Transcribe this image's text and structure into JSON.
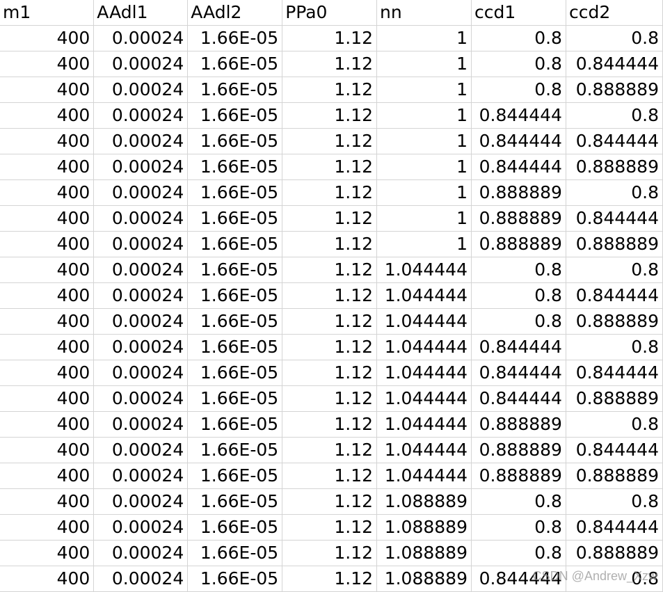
{
  "sheet": {
    "headers": [
      "m1",
      "AAdl1",
      "AAdl2",
      "PPa0",
      "nn",
      "ccd1",
      "ccd2"
    ],
    "rows": [
      [
        "400",
        "0.00024",
        "1.66E-05",
        "1.12",
        "1",
        "0.8",
        "0.8"
      ],
      [
        "400",
        "0.00024",
        "1.66E-05",
        "1.12",
        "1",
        "0.8",
        "0.844444"
      ],
      [
        "400",
        "0.00024",
        "1.66E-05",
        "1.12",
        "1",
        "0.8",
        "0.888889"
      ],
      [
        "400",
        "0.00024",
        "1.66E-05",
        "1.12",
        "1",
        "0.844444",
        "0.8"
      ],
      [
        "400",
        "0.00024",
        "1.66E-05",
        "1.12",
        "1",
        "0.844444",
        "0.844444"
      ],
      [
        "400",
        "0.00024",
        "1.66E-05",
        "1.12",
        "1",
        "0.844444",
        "0.888889"
      ],
      [
        "400",
        "0.00024",
        "1.66E-05",
        "1.12",
        "1",
        "0.888889",
        "0.8"
      ],
      [
        "400",
        "0.00024",
        "1.66E-05",
        "1.12",
        "1",
        "0.888889",
        "0.844444"
      ],
      [
        "400",
        "0.00024",
        "1.66E-05",
        "1.12",
        "1",
        "0.888889",
        "0.888889"
      ],
      [
        "400",
        "0.00024",
        "1.66E-05",
        "1.12",
        "1.044444",
        "0.8",
        "0.8"
      ],
      [
        "400",
        "0.00024",
        "1.66E-05",
        "1.12",
        "1.044444",
        "0.8",
        "0.844444"
      ],
      [
        "400",
        "0.00024",
        "1.66E-05",
        "1.12",
        "1.044444",
        "0.8",
        "0.888889"
      ],
      [
        "400",
        "0.00024",
        "1.66E-05",
        "1.12",
        "1.044444",
        "0.844444",
        "0.8"
      ],
      [
        "400",
        "0.00024",
        "1.66E-05",
        "1.12",
        "1.044444",
        "0.844444",
        "0.844444"
      ],
      [
        "400",
        "0.00024",
        "1.66E-05",
        "1.12",
        "1.044444",
        "0.844444",
        "0.888889"
      ],
      [
        "400",
        "0.00024",
        "1.66E-05",
        "1.12",
        "1.044444",
        "0.888889",
        "0.8"
      ],
      [
        "400",
        "0.00024",
        "1.66E-05",
        "1.12",
        "1.044444",
        "0.888889",
        "0.844444"
      ],
      [
        "400",
        "0.00024",
        "1.66E-05",
        "1.12",
        "1.044444",
        "0.888889",
        "0.888889"
      ],
      [
        "400",
        "0.00024",
        "1.66E-05",
        "1.12",
        "1.088889",
        "0.8",
        "0.8"
      ],
      [
        "400",
        "0.00024",
        "1.66E-05",
        "1.12",
        "1.088889",
        "0.8",
        "0.844444"
      ],
      [
        "400",
        "0.00024",
        "1.66E-05",
        "1.12",
        "1.088889",
        "0.8",
        "0.888889"
      ],
      [
        "400",
        "0.00024",
        "1.66E-05",
        "1.12",
        "1.088889",
        "0.844444",
        "0.8"
      ]
    ]
  },
  "watermark": "CSDN @Andrew_Xzw"
}
